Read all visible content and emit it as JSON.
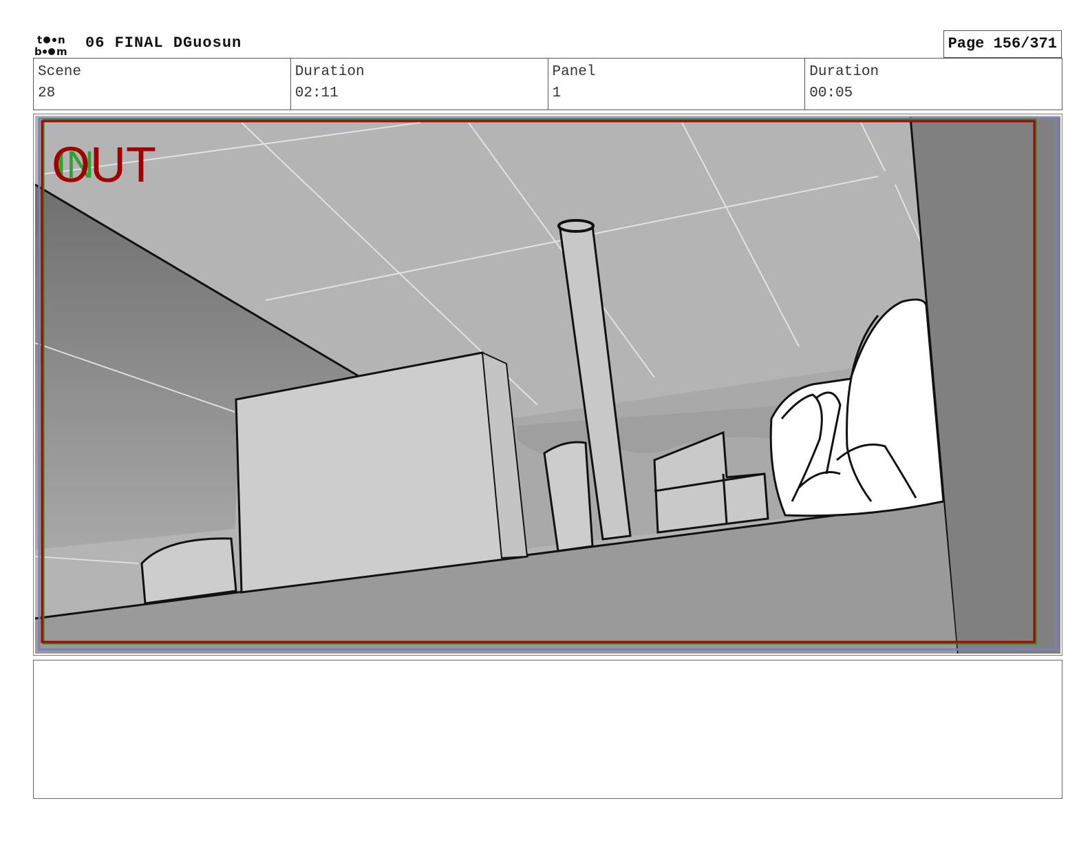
{
  "header": {
    "logo_alt": "toon boom",
    "project_title": "06 FINAL DGuosun",
    "page_label": "Page 156/371"
  },
  "info": {
    "scene_label": "Scene",
    "scene_value": "28",
    "scene_duration_label": "Duration",
    "scene_duration_value": "02:11",
    "panel_label": "Panel",
    "panel_value": "1",
    "panel_duration_label": "Duration",
    "panel_duration_value": "00:05"
  },
  "panel": {
    "overlay_in": "IN",
    "overlay_out": "OUT",
    "colors": {
      "in_green": "#2fa32f",
      "out_red": "#a00000",
      "frame_red": "#b00000",
      "frame_green": "#1f8a1f"
    }
  },
  "notes": {
    "text": ""
  }
}
